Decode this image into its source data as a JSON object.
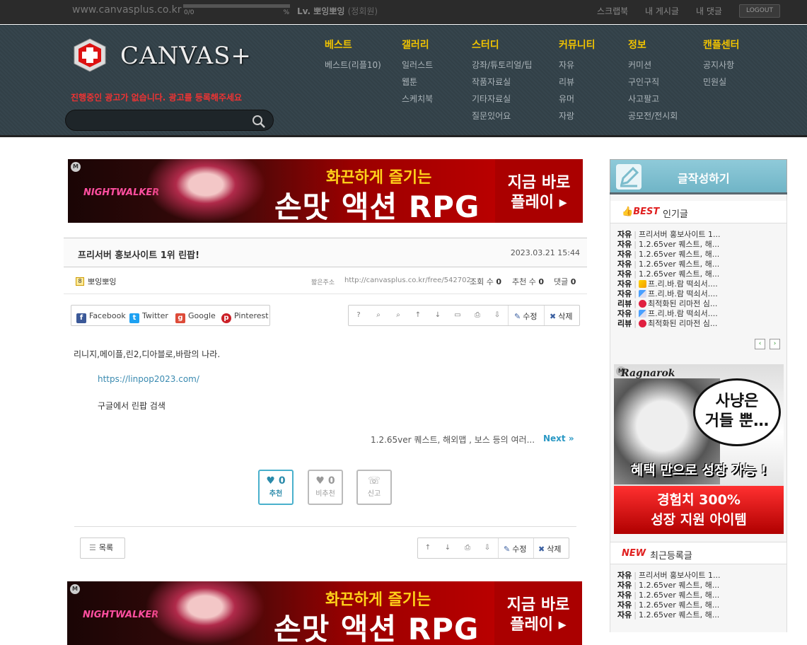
{
  "topbar": {
    "site_url": "www.canvasplus.co.kr",
    "progress_count": "0/0",
    "progress_pct_sign": "%",
    "progress_fraction": 0,
    "level_prefix": "Lv.",
    "user_name": "뽀잉뽀잉",
    "user_rank": "(정회원)",
    "links": [
      "스크랩북",
      "내 게시글",
      "내 댓글"
    ],
    "logout_label": "LOGOUT"
  },
  "header": {
    "logo_text": "CANVAS+",
    "ad_notice": "진행중인 광고가 없습니다. 광고를 등록해주세요",
    "search_placeholder": "",
    "menu": [
      {
        "head": "베스트",
        "items": [
          "베스트(리플10)"
        ]
      },
      {
        "head": "갤러리",
        "items": [
          "일러스트",
          "웹툰",
          "스케치북"
        ]
      },
      {
        "head": "스터디",
        "items": [
          "강좌/튜토리얼/팁",
          "작품자료실",
          "기타자료실",
          "질문있어요"
        ]
      },
      {
        "head": "커뮤니티",
        "items": [
          "자유",
          "리뷰",
          "유머",
          "자랑"
        ]
      },
      {
        "head": "정보",
        "items": [
          "커미션",
          "구인구직",
          "사고팔고",
          "공모전/전시회"
        ]
      },
      {
        "head": "캔플센터",
        "items": [
          "공지사항",
          "민원실"
        ]
      }
    ]
  },
  "banner": {
    "m_badge": "M",
    "brand": "NIGHTWALKER",
    "line1": "화끈하게 즐기는",
    "line2": "손맛 액션 RPG",
    "cta_line1": "지금 바로",
    "cta_line2": "플레이 ▸"
  },
  "post": {
    "title": "프리서버 홍보사이트 1위 린팝!",
    "date": "2023.03.21 15:44",
    "author": "뽀잉뽀잉",
    "short_url_label": "짧은주소",
    "short_url": "http://canvasplus.co.kr/free/542702",
    "views_label": "조회 수",
    "views": "0",
    "recommend_label": "추천 수",
    "recommend": "0",
    "comments_label": "댓글",
    "comments": "0",
    "share": [
      "Facebook",
      "Twitter",
      "Google",
      "Pinterest"
    ],
    "tools": [
      "?",
      "⌕",
      "⌕",
      "↑",
      "↓",
      "▭",
      "⎙",
      "⇩"
    ],
    "edit_label": "수정",
    "delete_label": "삭제",
    "body_line1": "리니지,메이플,린2,디아블로,바람의 나라.",
    "body_link": "https://linpop2023.com/",
    "body_line3": "구글에서 린팝 검색",
    "next_title": "1.2.65ver 퀘스트, 해외맵 , 보스 등의 여러...",
    "next_label": "Next »",
    "vote_up_count": "♥ 0",
    "vote_up_label": "추천",
    "vote_down_count": "♥ 0",
    "vote_down_label": "비추천",
    "report_icon": "☏",
    "report_label": "신고",
    "list_label": "목록",
    "bottom_tools": [
      "↑",
      "↓",
      "⎙",
      "⇩"
    ]
  },
  "sidebar": {
    "write_label": "글작성하기",
    "best_badge": "BEST",
    "best_title": "인기글",
    "best_posts": [
      {
        "cat": "자유",
        "title": "프리서버 홍보사이트 1...",
        "icon": ""
      },
      {
        "cat": "자유",
        "title": "1.2.65ver 퀘스트, 해...",
        "icon": ""
      },
      {
        "cat": "자유",
        "title": "1.2.65ver 퀘스트, 해...",
        "icon": ""
      },
      {
        "cat": "자유",
        "title": "1.2.65ver 퀘스트, 해...",
        "icon": ""
      },
      {
        "cat": "자유",
        "title": "1.2.65ver 퀘스트, 해...",
        "icon": ""
      },
      {
        "cat": "자유",
        "title": "프.리.바.람 떡쇠서....",
        "icon": "lightning"
      },
      {
        "cat": "자유",
        "title": "프.리.바.람 떡쇠서....",
        "icon": "pill"
      },
      {
        "cat": "리뷰",
        "title": "최적화된 리마전 심...",
        "icon": "heart"
      },
      {
        "cat": "자유",
        "title": "프.리.바.람 떡쇠서....",
        "icon": "pill"
      },
      {
        "cat": "리뷰",
        "title": "최적화된 리마전 심...",
        "icon": "heart"
      }
    ],
    "pager_prev": "‹",
    "pager_next": "›",
    "ad": {
      "m_badge": "M",
      "logo": "Ragnarok",
      "bubble_line1": "사냥은",
      "bubble_line2": "거들 뿐…",
      "mid": "혜택 만으로 성장 가능 !",
      "bot_line1": "경험치 300%",
      "bot_line2": "성장 지원 아이템"
    },
    "new_badge": "NEW",
    "new_title": "최근등록글",
    "new_posts": [
      {
        "cat": "자유",
        "title": "프리서버 홍보사이트 1...",
        "icon": ""
      },
      {
        "cat": "자유",
        "title": "1.2.65ver 퀘스트, 해...",
        "icon": ""
      },
      {
        "cat": "자유",
        "title": "1.2.65ver 퀘스트, 해...",
        "icon": ""
      },
      {
        "cat": "자유",
        "title": "1.2.65ver 퀘스트, 해...",
        "icon": ""
      },
      {
        "cat": "자유",
        "title": "1.2.65ver 퀘스트, 해...",
        "icon": ""
      }
    ]
  },
  "colors": {
    "menu_head": "#f2c400",
    "accent_blue": "#49b0cc",
    "notice_red": "#e33"
  }
}
